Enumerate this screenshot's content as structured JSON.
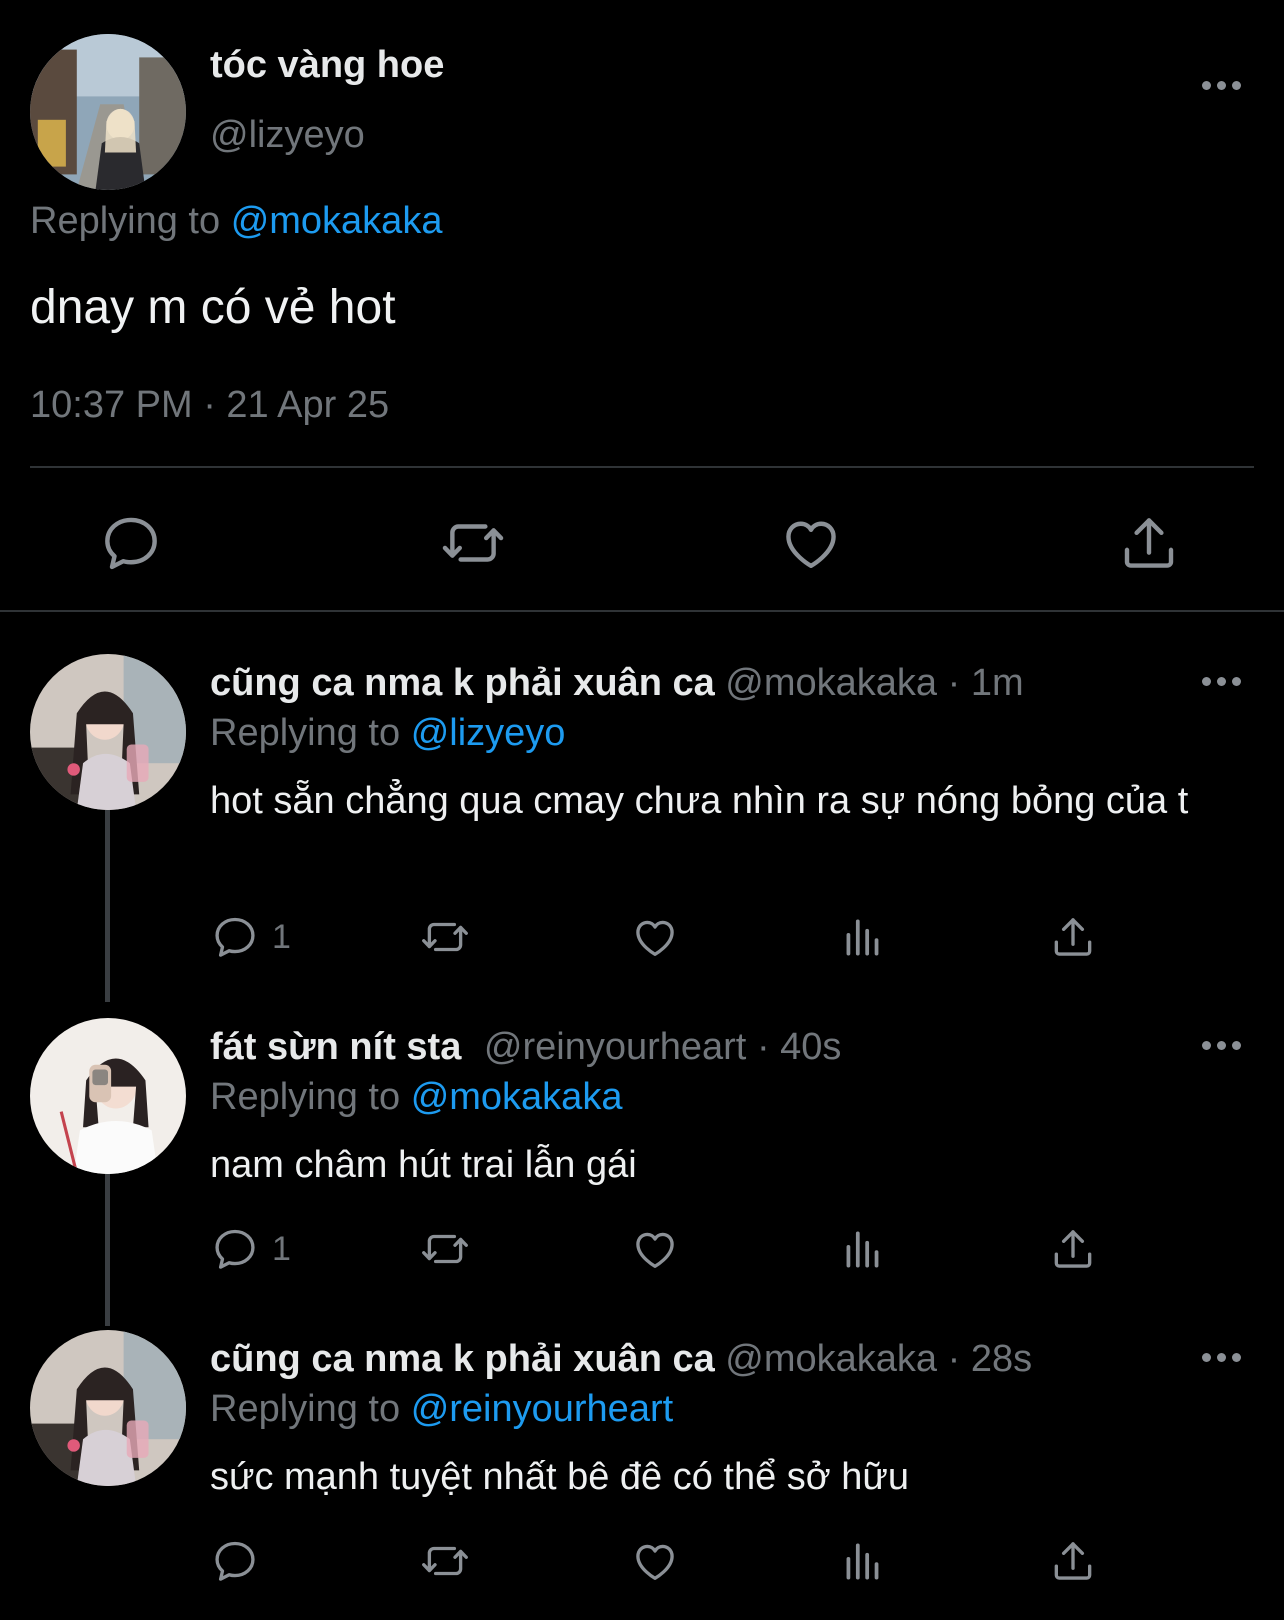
{
  "main_tweet": {
    "display_name": "tóc vàng hoe",
    "handle": "@lizyeyo",
    "replying_label": "Replying to",
    "replying_to": "@mokakaka",
    "text": "dnay m có vẻ hot",
    "timestamp": "10:37 PM · 21 Apr 25",
    "actions": [
      "reply-icon",
      "retweet-icon",
      "like-icon",
      "share-icon"
    ]
  },
  "replies": [
    {
      "display_name": "cũng ca nma k phải xuân ca",
      "handle": "@mokakaka",
      "time": "1m",
      "replying_label": "Replying to",
      "replying_to": "@lizyeyo",
      "text": "hot sẵn chẳng qua cmay chưa nhìn ra sự nóng bỏng của t",
      "reply_count": "1"
    },
    {
      "display_name": "fát sừn nít sta",
      "handle": "@reinyourheart",
      "time": "40s",
      "replying_label": "Replying to",
      "replying_to": "@mokakaka",
      "text": "nam châm hút trai lẫn gái",
      "reply_count": "1"
    },
    {
      "display_name": "cũng ca nma k phải xuân ca",
      "handle": "@mokakaka",
      "time": "28s",
      "replying_label": "Replying to",
      "replying_to": "@reinyourheart",
      "text": "sức mạnh tuyệt nhất bê đê có thể sở hữu",
      "reply_count": ""
    }
  ],
  "colors": {
    "background": "#000000",
    "text": "#e7e9ea",
    "secondary_text": "#71767b",
    "mention": "#1d9bf0",
    "divider": "#2f3336"
  }
}
